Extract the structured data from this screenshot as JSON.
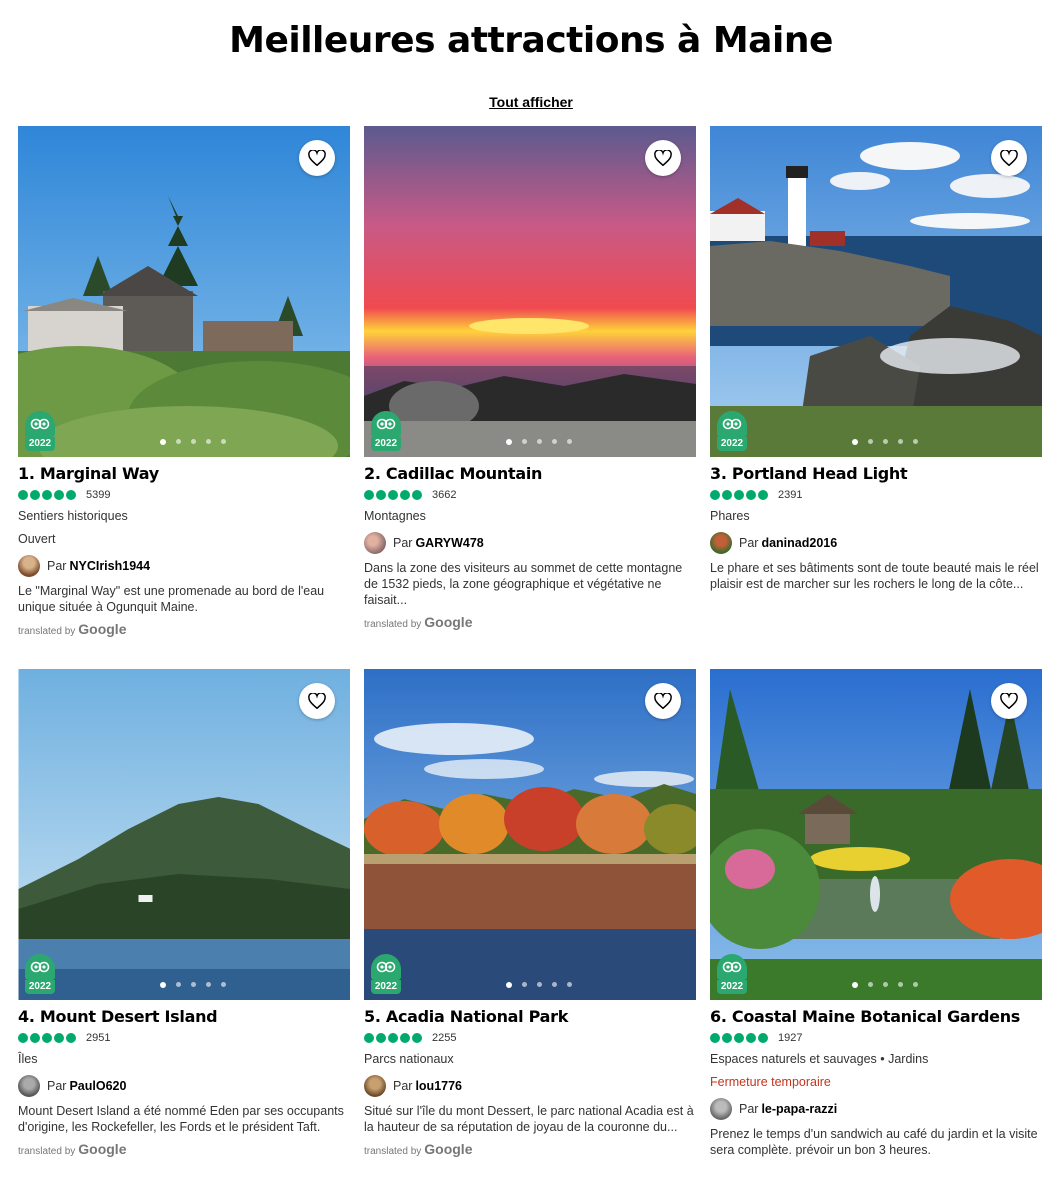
{
  "page": {
    "title": "Meilleures attractions à Maine",
    "view_all": "Tout afficher"
  },
  "translated_label": "translated by",
  "google_label": "Google",
  "by_label": "Par",
  "award_year": "2022",
  "colors": {
    "bubble": "#00aa6c",
    "award": "#2aa86f",
    "closed": "#c4341d"
  },
  "cards": [
    {
      "name": "1. Marginal Way",
      "rating_count": "5399",
      "category": "Sentiers historiques",
      "status": "Ouvert",
      "author": "NYCIrish1944",
      "snippet": "Le \"Marginal Way\" est une promenade au bord de l'eau unique située à Ogunquit Maine.",
      "translated": true
    },
    {
      "name": "2. Cadillac Mountain",
      "rating_count": "3662",
      "category": "Montagnes",
      "status": "",
      "author": "GARYW478",
      "snippet": "Dans la zone des visiteurs au sommet de cette montagne de 1532 pieds, la zone géographique et végétative ne faisait...",
      "translated": true
    },
    {
      "name": "3. Portland Head Light",
      "rating_count": "2391",
      "category": "Phares",
      "status": "",
      "author": "daninad2016",
      "snippet": "Le phare et ses bâtiments sont de toute beauté mais le réel plaisir est de marcher sur les rochers le long de la côte...",
      "translated": false
    },
    {
      "name": "4. Mount Desert Island",
      "rating_count": "2951",
      "category": "Îles",
      "status": "",
      "author": "PaulO620",
      "snippet": "Mount Desert Island a été nommé Eden par ses occupants d'origine, les Rockefeller, les Fords et le président Taft.",
      "translated": true
    },
    {
      "name": "5. Acadia National Park",
      "rating_count": "2255",
      "category": "Parcs nationaux",
      "status": "",
      "author": "lou1776",
      "snippet": "Situé sur l'île du mont Dessert, le parc national Acadia est à la hauteur de sa réputation de joyau de la couronne du...",
      "translated": true
    },
    {
      "name": "6. Coastal Maine Botanical Gardens",
      "rating_count": "1927",
      "category": "Espaces naturels et sauvages • Jardins",
      "status": "Fermeture temporaire",
      "author": "le-papa-razzi",
      "snippet": "Prenez le temps d'un sandwich au café du jardin et la visite sera complète. prévoir un bon 3 heures.",
      "translated": false
    }
  ]
}
